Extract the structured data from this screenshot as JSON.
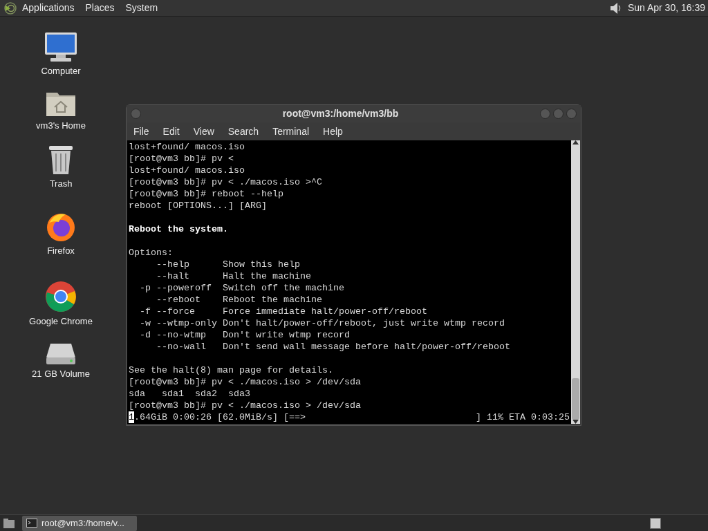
{
  "top_panel": {
    "menus": [
      "Applications",
      "Places",
      "System"
    ],
    "clock": "Sun Apr 30, 16:39"
  },
  "desktop_icons": [
    {
      "kind": "computer",
      "label": "Computer"
    },
    {
      "kind": "home",
      "label": "vm3's Home"
    },
    {
      "kind": "trash",
      "label": "Trash"
    },
    {
      "kind": "firefox",
      "label": "Firefox"
    },
    {
      "kind": "chrome",
      "label": "Google Chrome"
    },
    {
      "kind": "drive",
      "label": "21 GB Volume"
    }
  ],
  "window": {
    "title": "root@vm3:/home/vm3/bb",
    "menu": [
      "File",
      "Edit",
      "View",
      "Search",
      "Terminal",
      "Help"
    ],
    "lines": [
      {
        "kind": "text",
        "text": "lost+found/ macos.iso"
      },
      {
        "kind": "text",
        "text": "[root@vm3 bb]# pv <"
      },
      {
        "kind": "text",
        "text": "lost+found/ macos.iso"
      },
      {
        "kind": "text",
        "text": "[root@vm3 bb]# pv < ./macos.iso >^C"
      },
      {
        "kind": "text",
        "text": "[root@vm3 bb]# reboot --help"
      },
      {
        "kind": "text",
        "text": "reboot [OPTIONS...] [ARG]"
      },
      {
        "kind": "blank"
      },
      {
        "kind": "bold",
        "text": "Reboot the system."
      },
      {
        "kind": "blank"
      },
      {
        "kind": "text",
        "text": "Options:"
      },
      {
        "kind": "text",
        "text": "     --help      Show this help"
      },
      {
        "kind": "text",
        "text": "     --halt      Halt the machine"
      },
      {
        "kind": "text",
        "text": "  -p --poweroff  Switch off the machine"
      },
      {
        "kind": "text",
        "text": "     --reboot    Reboot the machine"
      },
      {
        "kind": "text",
        "text": "  -f --force     Force immediate halt/power-off/reboot"
      },
      {
        "kind": "text",
        "text": "  -w --wtmp-only Don't halt/power-off/reboot, just write wtmp record"
      },
      {
        "kind": "text",
        "text": "  -d --no-wtmp   Don't write wtmp record"
      },
      {
        "kind": "text",
        "text": "     --no-wall   Don't send wall message before halt/power-off/reboot"
      },
      {
        "kind": "blank"
      },
      {
        "kind": "text",
        "text": "See the halt(8) man page for details."
      },
      {
        "kind": "text",
        "text": "[root@vm3 bb]# pv < ./macos.iso > /dev/sda"
      },
      {
        "kind": "text",
        "text": "sda   sda1  sda2  sda3"
      },
      {
        "kind": "text",
        "text": "[root@vm3 bb]# pv < ./macos.iso > /dev/sda"
      },
      {
        "kind": "progress",
        "cursor": "1",
        "text": ".64GiB 0:00:26 [62.0MiB/s] [==>",
        "right": "] 11% ETA 0:03:25"
      }
    ]
  },
  "taskbar": {
    "tasks": [
      {
        "label": "root@vm3:/home/v...",
        "selected": true
      }
    ]
  }
}
